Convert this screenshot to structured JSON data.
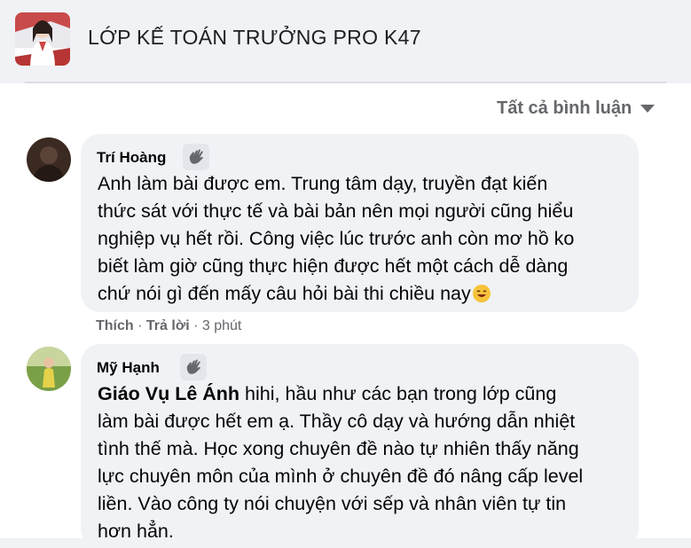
{
  "group": {
    "title": "LỚP KẾ TOÁN TRƯỞNG PRO K47"
  },
  "sort": {
    "label": "Tất cả bình luận"
  },
  "comments": [
    {
      "author": "Trí Hoàng",
      "lines": [
        "Anh làm bài được em. Trung tâm dạy, truyền đạt kiến",
        "thức sát với thực tế và bài bản nên mọi người cũng hiểu",
        "nghiệp vụ hết rồi. Công việc lúc trước anh còn mơ hồ ko",
        "biết làm giờ cũng thực hiện được hết một cách dễ dàng",
        "chứ nói gì đến mấy câu hỏi bài thi chiều nay"
      ],
      "like": "Thích",
      "reply": "Trả lời",
      "time": "· 3 phút"
    },
    {
      "author": "Mỹ Hạnh",
      "mention": "Giáo Vụ Lê Ánh",
      "first_line": " hihi, hầu như các bạn trong lớp cũng",
      "lines": [
        "làm bài được hết em ạ. Thầy cô dạy và hướng dẫn nhiệt",
        "tình thế mà. Học xong chuyên đề nào tự nhiên thấy năng",
        "lực chuyên môn của mình ở chuyên đề đó nâng cấp level",
        "liền. Vào công ty nói chuyện với sếp và nhân viên tự tin",
        "hơn hẳn."
      ]
    }
  ],
  "colors": {
    "page_bg": "#f0f2f5",
    "bubble_bg": "#f0f2f5",
    "muted": "#65676b"
  }
}
